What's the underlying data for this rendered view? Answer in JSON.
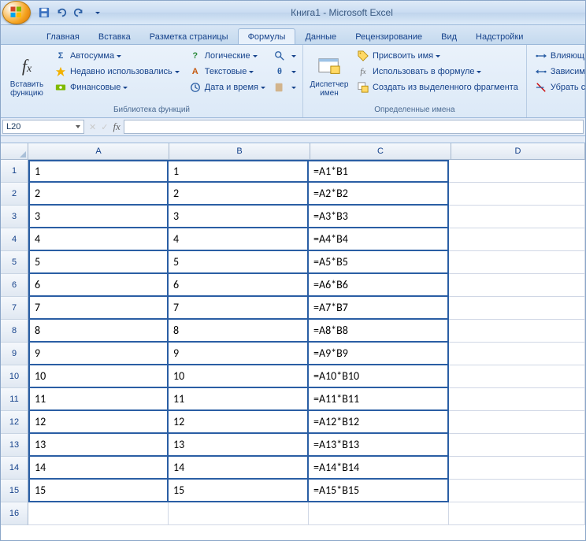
{
  "title": "Книга1 - Microsoft Excel",
  "tabs": {
    "home": "Главная",
    "insert": "Вставка",
    "page_layout": "Разметка страницы",
    "formulas": "Формулы",
    "data": "Данные",
    "review": "Рецензирование",
    "view": "Вид",
    "addins": "Надстройки"
  },
  "ribbon": {
    "insert_function": "Вставить функцию",
    "autosum": "Автосумма",
    "recently_used": "Недавно использовались",
    "financial": "Финансовые",
    "logical": "Логические",
    "text": "Текстовые",
    "date_time": "Дата и время",
    "lookup_icon": "",
    "math_icon": "",
    "more_icon": "",
    "library_label": "Библиотека функций",
    "name_manager": "Диспетчер имен",
    "define_name": "Присвоить имя",
    "use_in_formula": "Использовать в формуле",
    "create_from_selection": "Создать из выделенного фрагмента",
    "defined_names_label": "Определенные имена",
    "trace_precedents": "Влияющ",
    "trace_dependents": "Зависимы",
    "remove_arrows": "Убрать стр"
  },
  "formula_bar": {
    "name_box": "L20",
    "fx": "fx",
    "formula": ""
  },
  "columns": [
    "A",
    "B",
    "C",
    "D"
  ],
  "rows": [
    {
      "n": "1",
      "a": "1",
      "b": "1",
      "c": "=A1*B1"
    },
    {
      "n": "2",
      "a": "2",
      "b": "2",
      "c": "=A2*B2"
    },
    {
      "n": "3",
      "a": "3",
      "b": "3",
      "c": "=A3*B3"
    },
    {
      "n": "4",
      "a": "4",
      "b": "4",
      "c": "=A4*B4"
    },
    {
      "n": "5",
      "a": "5",
      "b": "5",
      "c": "=A5*B5"
    },
    {
      "n": "6",
      "a": "6",
      "b": "6",
      "c": "=A6*B6"
    },
    {
      "n": "7",
      "a": "7",
      "b": "7",
      "c": "=A7*B7"
    },
    {
      "n": "8",
      "a": "8",
      "b": "8",
      "c": "=A8*B8"
    },
    {
      "n": "9",
      "a": "9",
      "b": "9",
      "c": "=A9*B9"
    },
    {
      "n": "10",
      "a": "10",
      "b": "10",
      "c": "=A10*B10"
    },
    {
      "n": "11",
      "a": "11",
      "b": "11",
      "c": "=A11*B11"
    },
    {
      "n": "12",
      "a": "12",
      "b": "12",
      "c": "=A12*B12"
    },
    {
      "n": "13",
      "a": "13",
      "b": "13",
      "c": "=A13*B13"
    },
    {
      "n": "14",
      "a": "14",
      "b": "14",
      "c": "=A14*B14"
    },
    {
      "n": "15",
      "a": "15",
      "b": "15",
      "c": "=A15*B15"
    },
    {
      "n": "16",
      "a": "",
      "b": "",
      "c": ""
    }
  ]
}
